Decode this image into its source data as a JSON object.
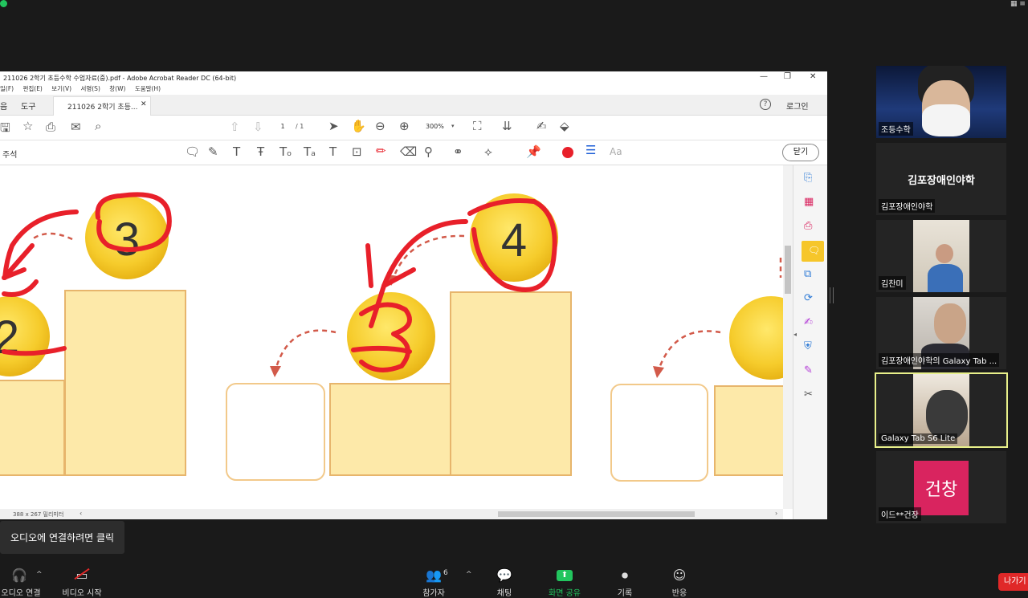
{
  "window": {
    "title": "211026 2학기 초등수학 수업자료(중).pdf - Adobe Acrobat Reader DC (64-bit)",
    "menus": [
      "일(F)",
      "편집(E)",
      "보기(V)",
      "서명(S)",
      "창(W)",
      "도움말(H)"
    ],
    "tabs": {
      "home": "음",
      "tools": "도구",
      "doc": "211026 2학기 초등...",
      "login": "로그인"
    },
    "page_current": "1",
    "page_total": "/ 1",
    "zoom": "300%",
    "comment_label": "주석",
    "close_label": "닫기",
    "status_size": "388 x 267 밀리미터"
  },
  "page_content": {
    "ball_labels": [
      "3",
      "4",
      "2"
    ]
  },
  "zoom_panel": {
    "tiles": [
      {
        "name": "조등수학",
        "type": "video"
      },
      {
        "name": "김포장애인야학",
        "center_text": "김포장애인야학",
        "type": "text"
      },
      {
        "name": "김찬미",
        "type": "video"
      },
      {
        "name": "김포장애인야학의 Galaxy Tab ...",
        "type": "video"
      },
      {
        "name": "Galaxy Tab S6 Lite",
        "type": "video",
        "active": true
      },
      {
        "name": "이드**건장",
        "avatar_text": "건창",
        "type": "avatar",
        "avatar_color": "#d9245f"
      }
    ]
  },
  "tooltip": "오디오에 연결하려면 클릭",
  "bottom_bar": {
    "audio": "오디오 연결",
    "video": "비디오 시작",
    "participants": "참가자",
    "participants_count": "6",
    "chat": "채팅",
    "share": "화면 공유",
    "record": "기록",
    "reactions": "반응",
    "leave": "나가기"
  },
  "colors": {
    "share_green": "#22c55e",
    "active_border": "#e8f08a",
    "leave_red": "#e02828",
    "ink_red": "#e8202a"
  }
}
